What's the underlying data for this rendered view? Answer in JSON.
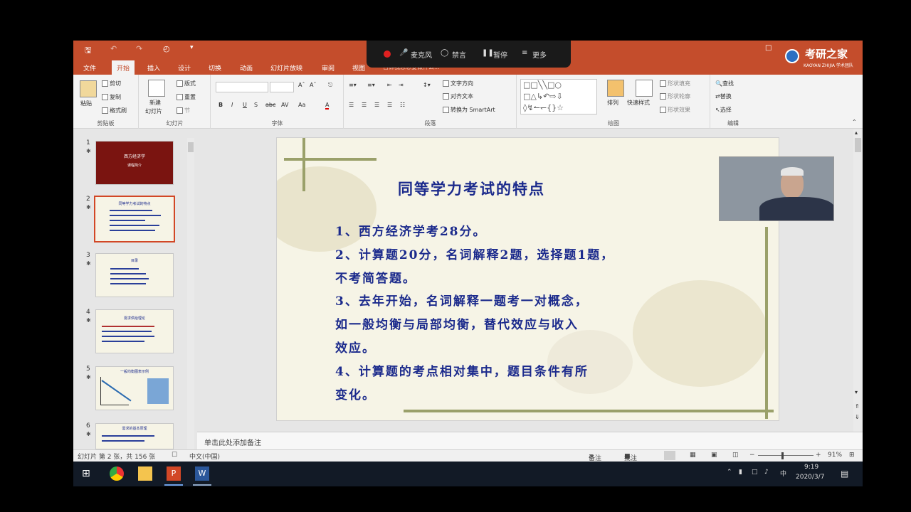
{
  "meeting": {
    "mic": "麦克风",
    "chat": "禁言",
    "pause": "暂停",
    "more": "更多"
  },
  "logo": {
    "name": "考研之家",
    "sub": "KAOYAN ZHIJIA 学术团队"
  },
  "tabs": [
    "文件",
    "开始",
    "插入",
    "设计",
    "切换",
    "动画",
    "幻灯片放映",
    "审阅",
    "视图"
  ],
  "tabs_tell": "告诉我您想要做什么...",
  "ribbon": {
    "clipboard": {
      "label": "剪贴板",
      "paste": "粘贴",
      "cut": "剪切",
      "copy": "复制",
      "format_painter": "格式刷"
    },
    "slides": {
      "label": "幻灯片",
      "new_slide": "新建",
      "new_slide2": "幻灯片",
      "layout": "版式",
      "reset": "重置",
      "section": "节"
    },
    "font": {
      "label": "字体",
      "bold": "B",
      "italic": "I",
      "underline": "U",
      "shadow": "S",
      "strike": "abc",
      "spacing": "AV",
      "case": "Aa",
      "color": "A"
    },
    "paragraph": {
      "label": "段落",
      "text_direction": "文字方向",
      "align_text": "对齐文本",
      "smartart": "转换为 SmartArt"
    },
    "drawing": {
      "label": "绘图",
      "arrange": "排列",
      "quick_styles": "快速样式",
      "shape_fill": "形状填充",
      "shape_outline": "形状轮廓",
      "shape_effects": "形状效果"
    },
    "editing": {
      "label": "编辑",
      "find": "查找",
      "replace": "替换",
      "select": "选择"
    }
  },
  "thumbnails": [
    {
      "num": "1",
      "title": "西方经济学",
      "sub": "课程简介"
    },
    {
      "num": "2",
      "title": "同等学力考试的特点"
    },
    {
      "num": "3",
      "title": "目录"
    },
    {
      "num": "4",
      "title": "需求供给理论"
    },
    {
      "num": "5",
      "title": "一般均衡图表示例"
    },
    {
      "num": "6",
      "title": "需求的基本原理"
    }
  ],
  "slide": {
    "title": "同等学力考试的特点",
    "lines": [
      "1、西方经济学考28分。",
      "2、计算题20分，名词解释2题，选择题1题，",
      "不考简答题。",
      "3、去年开始，名词解释一题考一对概念，",
      "如一般均衡与局部均衡，替代效应与收入",
      "效应。",
      "4、计算题的考点相对集中，题目条件有所",
      "变化。"
    ]
  },
  "notes_placeholder": "单击此处添加备注",
  "status": {
    "slide_info": "幻灯片 第 2 张，共 156 张",
    "language": "中文(中国)",
    "notes": "备注",
    "comments": "批注",
    "zoom": "91%"
  },
  "taskbar": {
    "time": "9:19",
    "date": "2020/3/7",
    "ime": "中"
  }
}
